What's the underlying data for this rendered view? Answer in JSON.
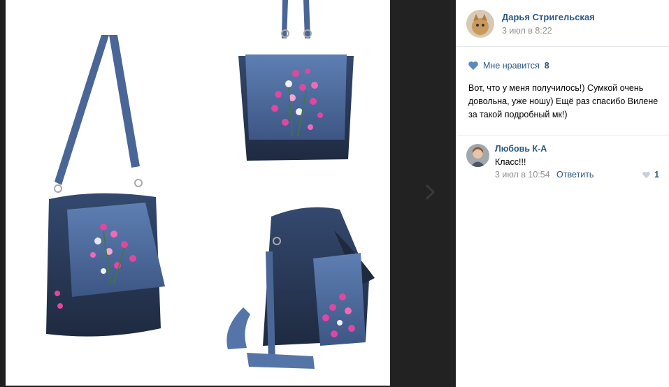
{
  "post": {
    "author_name": "Дарья Стригельская",
    "date": "3 июл в 8:22",
    "likes_label": "Мне нравится",
    "likes_count": "8",
    "text": "Вот, что у меня получилось!) Сумкой очень довольна, уже ношу) Ещё раз спасибо Вилене за такой подробный мк!)"
  },
  "comment": {
    "author_name": "Любовь К-А",
    "text": "Класс!!!",
    "date": "3 июл в 10:54",
    "reply_label": "Ответить",
    "likes_count": "1"
  },
  "icons": {
    "next": "chevron-right-icon",
    "like": "heart-icon"
  },
  "colors": {
    "link": "#2a5885",
    "muted": "#939393",
    "viewer_bg": "#1f1f1f",
    "denim": "#4d6d9e",
    "dark_denim": "#2d3d57",
    "flower_pink": "#e0479e"
  }
}
